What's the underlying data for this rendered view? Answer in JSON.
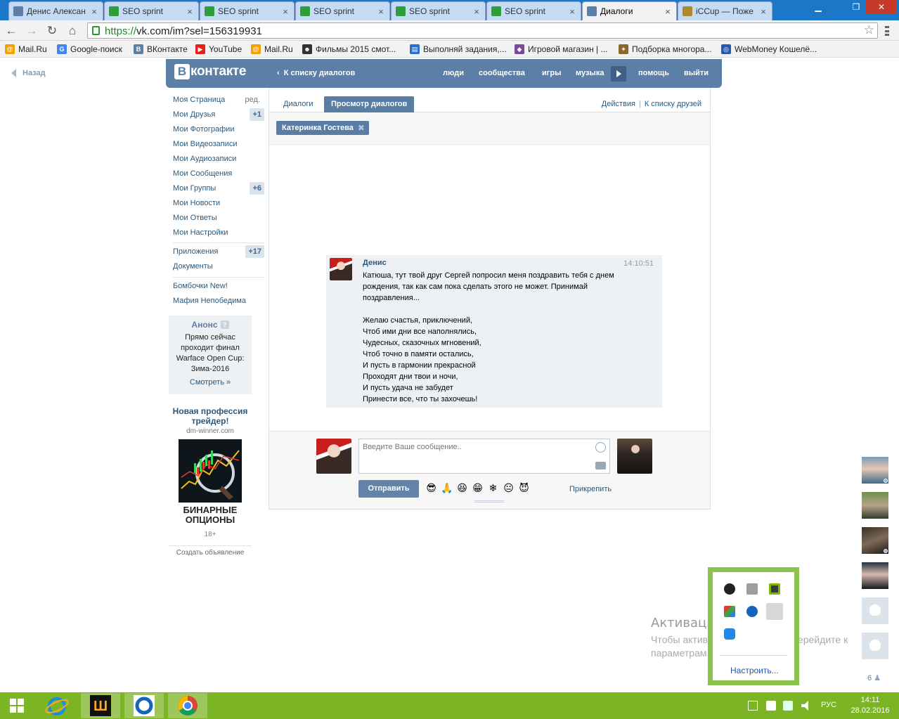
{
  "browser": {
    "tabs": [
      {
        "label": "Денис Алексан",
        "icon": "vk-favicon",
        "color": "#5b7fa6"
      },
      {
        "label": "SEO sprint",
        "icon": "seosprint-favicon",
        "color": "#2e9d3b"
      },
      {
        "label": "SEO sprint",
        "icon": "seosprint-favicon",
        "color": "#2e9d3b"
      },
      {
        "label": "SEO sprint",
        "icon": "seosprint-favicon",
        "color": "#2e9d3b"
      },
      {
        "label": "SEO sprint",
        "icon": "seosprint-favicon",
        "color": "#2e9d3b"
      },
      {
        "label": "SEO sprint",
        "icon": "seosprint-favicon",
        "color": "#2e9d3b"
      },
      {
        "label": "Диалоги",
        "icon": "vk-dialogs-favicon",
        "color": "#5b7fa6",
        "active": true
      },
      {
        "label": "iCCup — Поже",
        "icon": "iccup-favicon",
        "color": "#b08a2a"
      }
    ],
    "url_scheme": "https://",
    "url_rest": "vk.com/im?sel=156319931",
    "bookmarks": [
      {
        "label": "Mail.Ru",
        "color": "#f2a100",
        "glyph": "@"
      },
      {
        "label": "Google-поиск",
        "color": "#4285f4",
        "glyph": "G"
      },
      {
        "label": "ВКонтакте",
        "color": "#5b7fa6",
        "glyph": "В"
      },
      {
        "label": "YouTube",
        "color": "#e62117",
        "glyph": "▶"
      },
      {
        "label": "Mail.Ru",
        "color": "#f2a100",
        "glyph": "@"
      },
      {
        "label": "Фильмы 2015 смот...",
        "color": "#333333",
        "glyph": "☻"
      },
      {
        "label": "Выполняй задания,...",
        "color": "#2a6cc9",
        "glyph": "▤"
      },
      {
        "label": "Игровой магазин | ...",
        "color": "#7a4a9a",
        "glyph": "◆"
      },
      {
        "label": "Подборка многора...",
        "color": "#8a6a2a",
        "glyph": "✦"
      },
      {
        "label": "WebMoney Кошелё...",
        "color": "#2a5aa9",
        "glyph": "◎"
      }
    ]
  },
  "vk": {
    "back_label": "Назад",
    "logo_letter": "В",
    "logo_text": "контакте",
    "back_to_dialogs": "К списку диалогов",
    "nav": [
      "люди",
      "сообщества",
      "игры",
      "музыка",
      "помощь",
      "выйти"
    ],
    "menu": [
      {
        "label": "Моя Страница",
        "edit": "ред."
      },
      {
        "label": "Мои Друзья",
        "count": "+1"
      },
      {
        "label": "Мои Фотографии"
      },
      {
        "label": "Мои Видеозаписи"
      },
      {
        "label": "Мои Аудиозаписи"
      },
      {
        "label": "Мои Сообщения"
      },
      {
        "label": "Мои Группы",
        "count": "+6"
      },
      {
        "label": "Мои Новости"
      },
      {
        "label": "Мои Ответы"
      },
      {
        "label": "Мои Настройки"
      }
    ],
    "menu2": [
      {
        "label": "Приложения",
        "count": "+17"
      },
      {
        "label": "Документы"
      }
    ],
    "menu3": [
      {
        "label": "Бомбочки New!"
      },
      {
        "label": "Мафия Непобедима"
      }
    ],
    "anons": {
      "title": "Анонс",
      "help": "?",
      "text": "Прямо сейчас проходит финал Warface Open Cup: Зима-2016",
      "more": "Смотреть »"
    },
    "ad": {
      "title": "Новая профессия трейдер!",
      "domain": "dm-winner.com",
      "caption": "БИНАРНЫЕ ОПЦИОНЫ",
      "age": "18+",
      "create": "Создать объявление"
    },
    "dialog": {
      "tabs": [
        "Диалоги",
        "Просмотр диалогов"
      ],
      "actions": "Действия",
      "to_friends": "К списку друзей",
      "peer": "Катеринка Гостева",
      "message": {
        "author": "Денис",
        "time": "14:10:51",
        "text": "Катюша, тут твой друг Сергей попросил меня поздравить тебя с днем рождения, так как сам пока сделать этого не может. Принимай поздравления...\n\nЖелаю счастья, приключений,\nЧтоб ими дни все наполнялись,\nЧудесных, сказочных мгновений,\nЧтоб точно в памяти остались,\nИ пусть в гармонии прекрасной\nПроходят дни твои и ночи,\nИ пусть удача не забудет\nПринести все, что ты захочешь!"
      },
      "input_placeholder": "Введите Ваше сообщение..",
      "send": "Отправить",
      "emojis": [
        "😎",
        "🙏",
        "😆",
        "😁",
        "❄",
        "😐",
        "😈"
      ],
      "attach": "Прикрепить"
    },
    "friends_online_count": "6"
  },
  "windows": {
    "activation_title": "Активация Windows",
    "activation_text": "Чтобы активировать Windows, перейдите к параметрам компьютера.",
    "tray_configure": "Настроить...",
    "lang": "РУС",
    "time": "14:11",
    "date": "28.02.2016"
  }
}
